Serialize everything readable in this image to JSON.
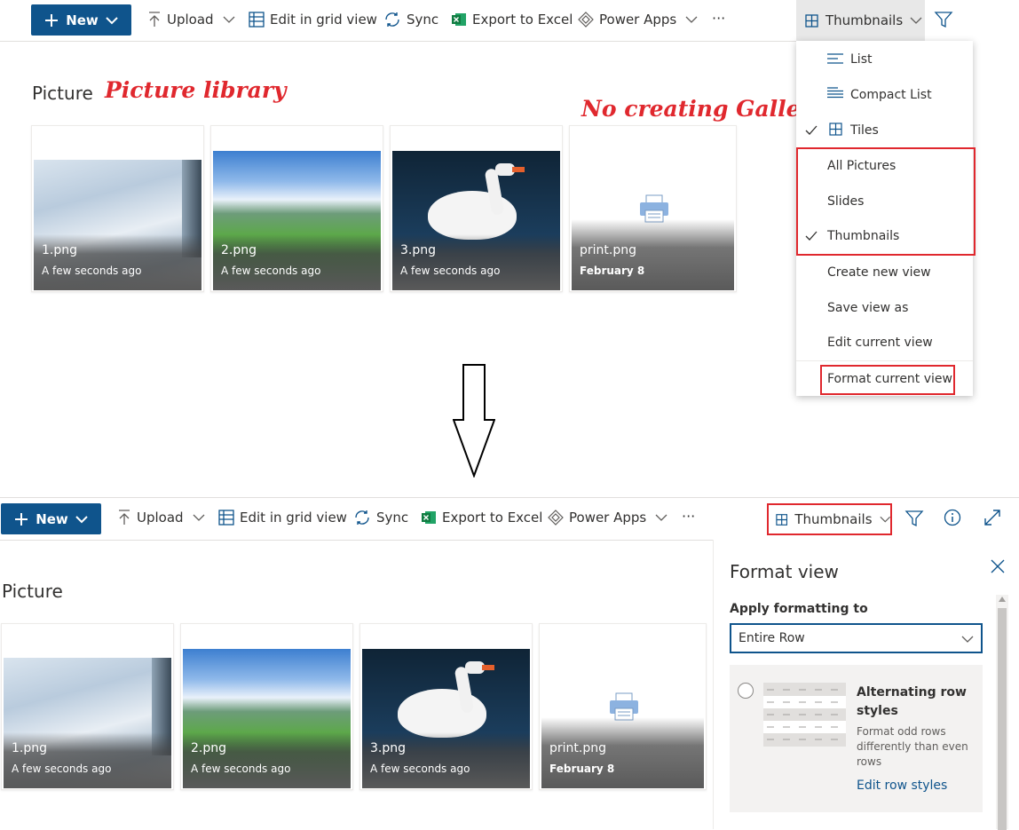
{
  "colors": {
    "brand": "#0f548c",
    "annotation": "#e0282e",
    "excel": "#107c41"
  },
  "top": {
    "toolbar": {
      "new_label": "New",
      "upload_label": "Upload",
      "edit_grid_label": "Edit in grid view",
      "sync_label": "Sync",
      "export_label": "Export to Excel",
      "powerapps_label": "Power Apps",
      "more_label": "···",
      "view_label": "Thumbnails"
    },
    "library_title": "Picture",
    "annotation_library": "Picture library",
    "annotation_gallery": "No creating Gallery view",
    "cards": [
      {
        "name": "1.png",
        "date": "A few seconds ago"
      },
      {
        "name": "2.png",
        "date": "A few seconds ago"
      },
      {
        "name": "3.png",
        "date": "A few seconds ago"
      },
      {
        "name": "print.png",
        "date": "February 8"
      }
    ],
    "view_menu": {
      "items": [
        "List",
        "Compact List",
        "Tiles",
        "All Pictures",
        "Slides",
        "Thumbnails",
        "Create new view",
        "Save view as",
        "Edit current view",
        "Format current view"
      ],
      "checked": [
        "Tiles",
        "Thumbnails"
      ]
    }
  },
  "bottom": {
    "toolbar": {
      "new_label": "New",
      "upload_label": "Upload",
      "edit_grid_label": "Edit in grid view",
      "sync_label": "Sync",
      "export_label": "Export to Excel",
      "powerapps_label": "Power Apps",
      "more_label": "···",
      "view_label": "Thumbnails"
    },
    "library_title": "Picture",
    "cards": [
      {
        "name": "1.png",
        "date": "A few seconds ago"
      },
      {
        "name": "2.png",
        "date": "A few seconds ago"
      },
      {
        "name": "3.png",
        "date": "A few seconds ago"
      },
      {
        "name": "print.png",
        "date": "February 8"
      }
    ],
    "format_panel": {
      "title": "Format view",
      "apply_label": "Apply formatting to",
      "apply_value": "Entire Row",
      "option_title": "Alternating row styles",
      "option_desc": "Format odd rows differently than even rows",
      "option_link": "Edit row styles"
    }
  }
}
